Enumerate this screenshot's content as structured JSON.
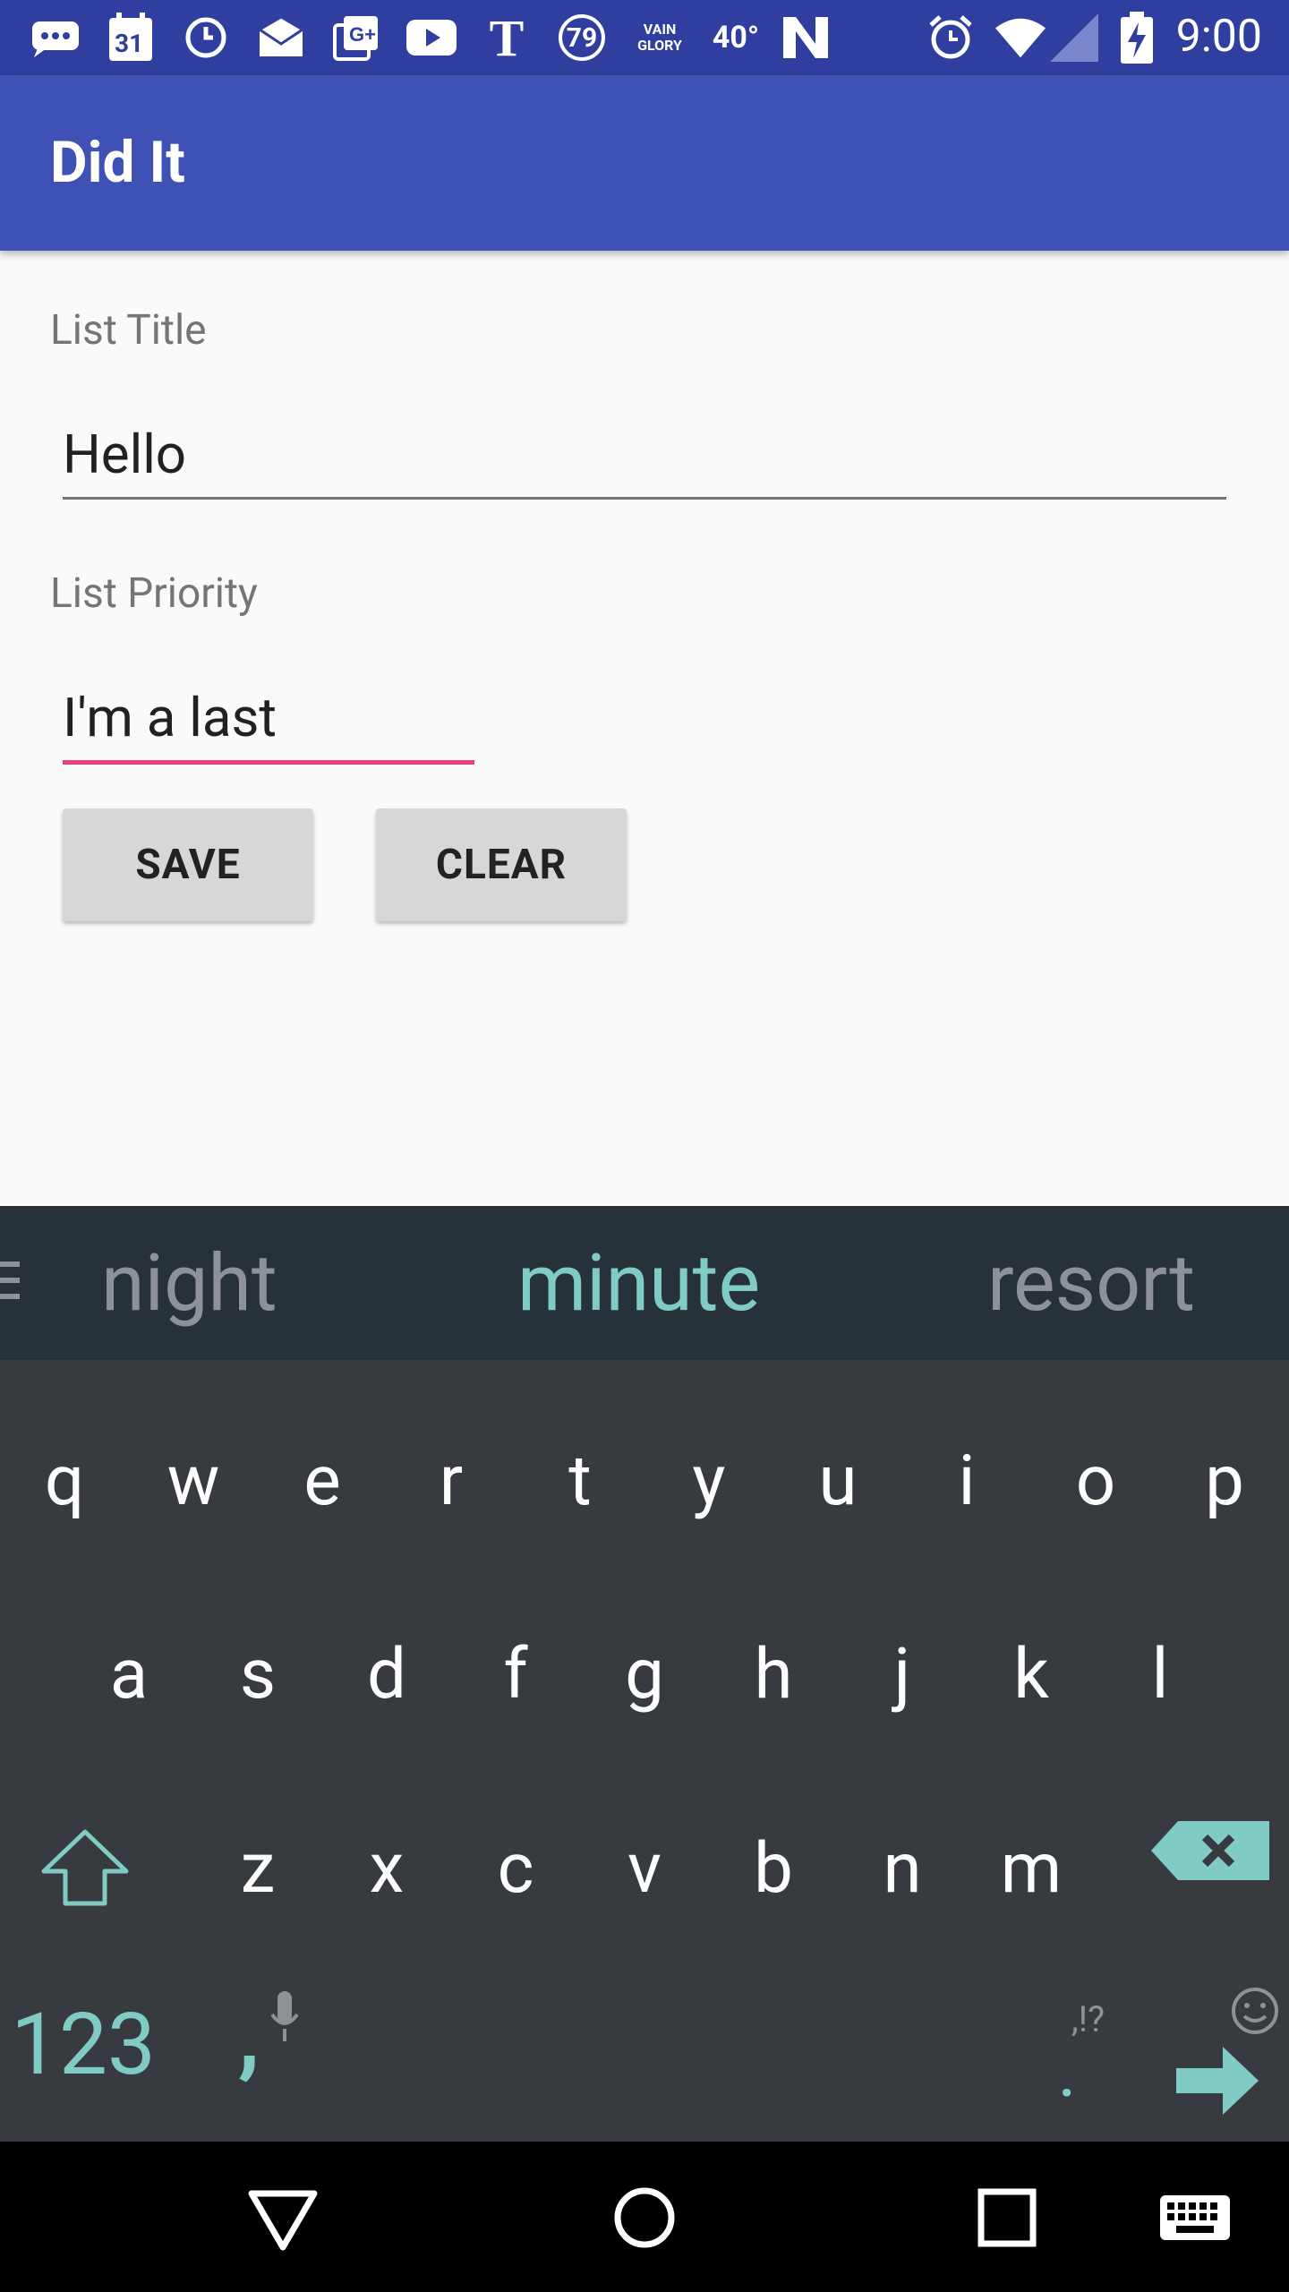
{
  "status_bar": {
    "time": "9:00",
    "calendar_day": "31",
    "carrier_glyph": "T",
    "badge_79": "79",
    "vainglory_label": "VAIN GLORY",
    "temperature": "40°",
    "left_icons": [
      "messages-icon",
      "calendar-icon",
      "clock-icon",
      "email-icon",
      "google-plus-icon",
      "youtube-icon",
      "t-mobile-icon",
      "badge-79-icon",
      "vainglory-icon",
      "temperature-icon",
      "n-icon"
    ],
    "right_icons": [
      "alarm-icon",
      "wifi-icon",
      "signal-icon",
      "battery-charging-icon"
    ]
  },
  "app_bar": {
    "title": "Did It",
    "color": "#3f51b5"
  },
  "form": {
    "title_label": "List Title",
    "title_value": "Hello",
    "priority_label": "List Priority",
    "priority_value": "I'm a last",
    "accent_color": "#ec407a"
  },
  "buttons": {
    "save": "SAVE",
    "clear": "CLEAR"
  },
  "keyboard": {
    "suggestions": [
      "night",
      "minute",
      "resort"
    ],
    "row1": [
      "q",
      "w",
      "e",
      "r",
      "t",
      "y",
      "u",
      "i",
      "o",
      "p"
    ],
    "row2": [
      "a",
      "s",
      "d",
      "f",
      "g",
      "h",
      "j",
      "k",
      "l"
    ],
    "row3": [
      "z",
      "x",
      "c",
      "v",
      "b",
      "n",
      "m"
    ],
    "numbers_key": "123",
    "comma_key": ",",
    "period_key": ".",
    "punct_hint": ",!?",
    "accent_color": "#80cbc4"
  },
  "nav_bar": {
    "buttons": [
      "back-icon",
      "home-icon",
      "recents-icon",
      "keyboard-icon"
    ]
  }
}
